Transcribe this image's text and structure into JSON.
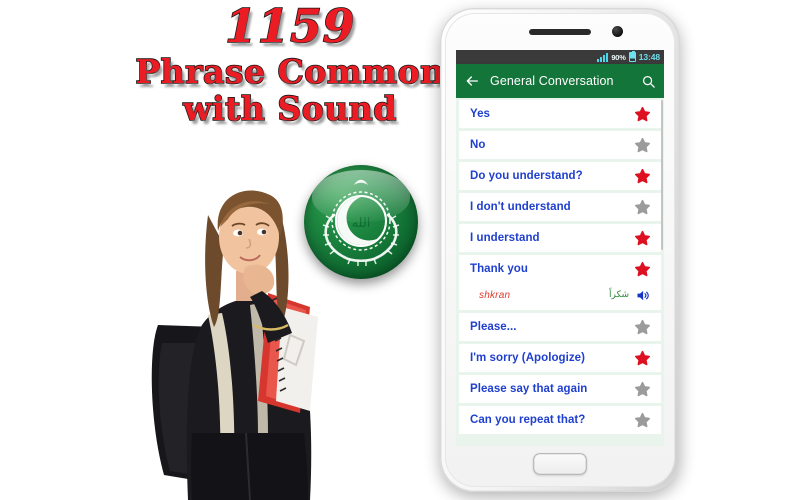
{
  "promo": {
    "count": "1159",
    "line2": "Phrase Common",
    "line3": "with Sound",
    "text_color": "#ec1c24",
    "outline_color": "#151515"
  },
  "badge": {
    "name": "arab-league-emblem",
    "base_color": "#1e8a42",
    "emblem_color": "#ffffff"
  },
  "student": {
    "alt": "student girl with backpack holding books, thinking pose"
  },
  "phone": {
    "frame_color": "#f4f4f4",
    "statusbar": {
      "battery_percent": "90%",
      "time": "13:48",
      "bar_color": "#3a3a3a",
      "icon_color": "#6fdfee"
    },
    "appbar": {
      "title": "General Conversation",
      "back_icon": "arrow-left-icon",
      "search_icon": "search-icon",
      "color": "#14753a"
    },
    "list": {
      "label_color": "#1f3fcf",
      "star_on_color": "#dd1122",
      "star_off_color": "#9b9b9b",
      "items": [
        {
          "label": "Yes",
          "starred": true
        },
        {
          "label": "No",
          "starred": false
        },
        {
          "label": "Do you understand?",
          "starred": true
        },
        {
          "label": "I don't understand",
          "starred": false
        },
        {
          "label": "I understand",
          "starred": true
        },
        {
          "label": "Thank you",
          "starred": true,
          "expanded": true,
          "arabic": "شكراً",
          "transliteration": "shkran",
          "audio_icon": "speaker-icon"
        },
        {
          "label": "Please...",
          "starred": false
        },
        {
          "label": "I'm sorry (Apologize)",
          "starred": true
        },
        {
          "label": "Please say that again",
          "starred": false
        },
        {
          "label": "Can you repeat that?",
          "starred": false
        }
      ]
    }
  }
}
